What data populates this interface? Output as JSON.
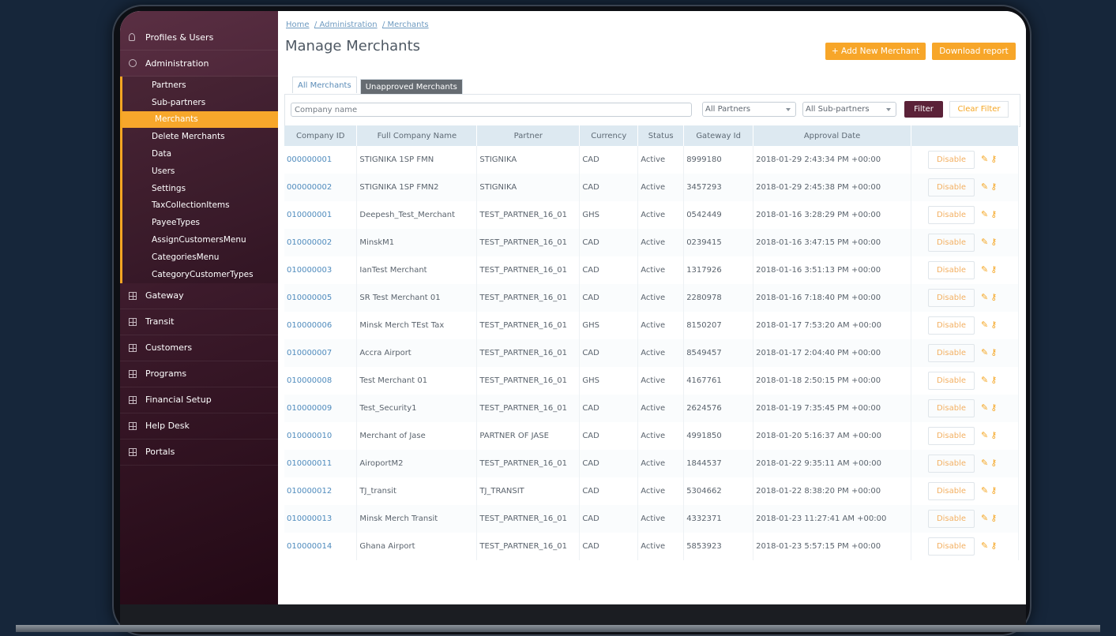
{
  "sidebar": {
    "items_top": [
      {
        "label": "Profiles & Users",
        "icon": "user-icon"
      },
      {
        "label": "Administration",
        "icon": "gear-icon"
      }
    ],
    "submenu": [
      "Partners",
      "Sub-partners",
      "Merchants",
      "Delete Merchants",
      "Data",
      "Users",
      "Settings",
      "TaxCollectionItems",
      "PayeeTypes",
      "AssignCustomersMenu",
      "CategoriesMenu",
      "CategoryCustomerTypes"
    ],
    "active_submenu": "Merchants",
    "items_bottom": [
      "Gateway",
      "Transit",
      "Customers",
      "Programs",
      "Financial Setup",
      "Help Desk",
      "Portals"
    ]
  },
  "breadcrumb": {
    "home": "Home",
    "admin": "/ Administration",
    "current": "/ Merchants"
  },
  "page_title": "Manage Merchants",
  "actions": {
    "add": "+ Add New Merchant",
    "download": "Download report"
  },
  "tabs": {
    "all": "All Merchants",
    "unapproved": "Unapproved Merchants"
  },
  "filters": {
    "company_placeholder": "Company name",
    "partners": "All Partners",
    "subpartners": "All Sub-partners",
    "filter_btn": "Filter",
    "clear_btn": "Clear Filter"
  },
  "table": {
    "headers": [
      "Company ID",
      "Full Company Name",
      "Partner",
      "Currency",
      "Status",
      "Gateway Id",
      "Approval Date",
      ""
    ],
    "disable_label": "Disable",
    "rows": [
      [
        "000000001",
        "STIGNIKA 1SP FMN",
        "STIGNIKA",
        "CAD",
        "Active",
        "8999180",
        "2018-01-29 2:43:34 PM +00:00"
      ],
      [
        "000000002",
        "STIGNIKA 1SP FMN2",
        "STIGNIKA",
        "CAD",
        "Active",
        "3457293",
        "2018-01-29 2:45:38 PM +00:00"
      ],
      [
        "010000001",
        "Deepesh_Test_Merchant",
        "TEST_PARTNER_16_01",
        "GHS",
        "Active",
        "0542449",
        "2018-01-16 3:28:29 PM +00:00"
      ],
      [
        "010000002",
        "MinskM1",
        "TEST_PARTNER_16_01",
        "CAD",
        "Active",
        "0239415",
        "2018-01-16 3:47:15 PM +00:00"
      ],
      [
        "010000003",
        "IanTest Merchant",
        "TEST_PARTNER_16_01",
        "CAD",
        "Active",
        "1317926",
        "2018-01-16 3:51:13 PM +00:00"
      ],
      [
        "010000005",
        "SR Test Merchant 01",
        "TEST_PARTNER_16_01",
        "CAD",
        "Active",
        "2280978",
        "2018-01-16 7:18:40 PM +00:00"
      ],
      [
        "010000006",
        "Minsk Merch TEst Tax",
        "TEST_PARTNER_16_01",
        "GHS",
        "Active",
        "8150207",
        "2018-01-17 7:53:20 AM +00:00"
      ],
      [
        "010000007",
        "Accra Airport",
        "TEST_PARTNER_16_01",
        "CAD",
        "Active",
        "8549457",
        "2018-01-17 2:04:40 PM +00:00"
      ],
      [
        "010000008",
        "Test Merchant 01",
        "TEST_PARTNER_16_01",
        "GHS",
        "Active",
        "4167761",
        "2018-01-18 2:50:15 PM +00:00"
      ],
      [
        "010000009",
        "Test_Security1",
        "TEST_PARTNER_16_01",
        "CAD",
        "Active",
        "2624576",
        "2018-01-19 7:35:45 PM +00:00"
      ],
      [
        "010000010",
        "Merchant of Jase",
        "PARTNER OF JASE",
        "CAD",
        "Active",
        "4991850",
        "2018-01-20 5:16:37 AM +00:00"
      ],
      [
        "010000011",
        "AiroportM2",
        "TEST_PARTNER_16_01",
        "CAD",
        "Active",
        "1844537",
        "2018-01-22 9:35:11 AM +00:00"
      ],
      [
        "010000012",
        "TJ_transit",
        "TJ_TRANSIT",
        "CAD",
        "Active",
        "5304662",
        "2018-01-22 8:38:20 PM +00:00"
      ],
      [
        "010000013",
        "Minsk Merch Transit",
        "TEST_PARTNER_16_01",
        "CAD",
        "Active",
        "4332371",
        "2018-01-23 11:27:41 AM +00:00"
      ],
      [
        "010000014",
        "Ghana Airport",
        "TEST_PARTNER_16_01",
        "CAD",
        "Active",
        "5853923",
        "2018-01-23 5:57:15 PM +00:00"
      ]
    ]
  },
  "colors": {
    "accent": "#f7a629",
    "sidebar": "#3d1b2c",
    "filter_button": "#5b2238"
  }
}
